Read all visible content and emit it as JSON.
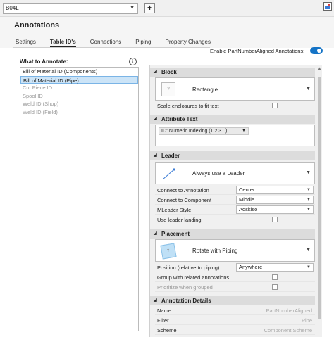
{
  "toolbar": {
    "selected_style": "B04L",
    "add_label": "+"
  },
  "header": {
    "title": "Annotations",
    "tabs": [
      "Settings",
      "Table ID's",
      "Connections",
      "Piping",
      "Property Changes"
    ],
    "active_tab": "Table ID's",
    "toggle_label": "Enable PartNumberAligned Annotations:",
    "toggle_on": true
  },
  "left": {
    "label": "What to Annotate:",
    "items": [
      {
        "label": "Bill of Material ID (Components)",
        "state": "normal"
      },
      {
        "label": "Bill of Material ID (Pipe)",
        "state": "selected"
      },
      {
        "label": "Cut Piece ID",
        "state": "disabled"
      },
      {
        "label": "Spool ID",
        "state": "disabled"
      },
      {
        "label": "Weld ID (Shop)",
        "state": "disabled"
      },
      {
        "label": "Weld ID (Field)",
        "state": "disabled"
      }
    ]
  },
  "block": {
    "title": "Block",
    "style": "Rectangle",
    "scale_label": "Scale enclosures to fit text"
  },
  "attribute": {
    "title": "Attribute Text",
    "value": "ID: Numeric Indexing (1,2,3...)"
  },
  "leader": {
    "title": "Leader",
    "style": "Always use a Leader",
    "rows": [
      {
        "key": "Connect to Annotation",
        "value": "Center"
      },
      {
        "key": "Connect to Component",
        "value": "Middle"
      },
      {
        "key": "MLeader Style",
        "value": "Adsklso"
      }
    ],
    "landing_label": "Use leader landing"
  },
  "placement": {
    "title": "Placement",
    "style": "Rotate with Piping",
    "position_key": "Position (relative to piping)",
    "position_value": "Anywhere",
    "group_label": "Group with related annotations",
    "prioritize_label": "Prioritize when grouped"
  },
  "details": {
    "title": "Annotation Details",
    "rows": [
      {
        "key": "Name",
        "value": "PartNumberAligned"
      },
      {
        "key": "Filter",
        "value": "Pipe"
      },
      {
        "key": "Scheme",
        "value": "Component Scheme"
      }
    ]
  },
  "colors": {
    "accent": "#1473c6",
    "selection": "#cce4f7",
    "section": "#dcdcdc"
  }
}
